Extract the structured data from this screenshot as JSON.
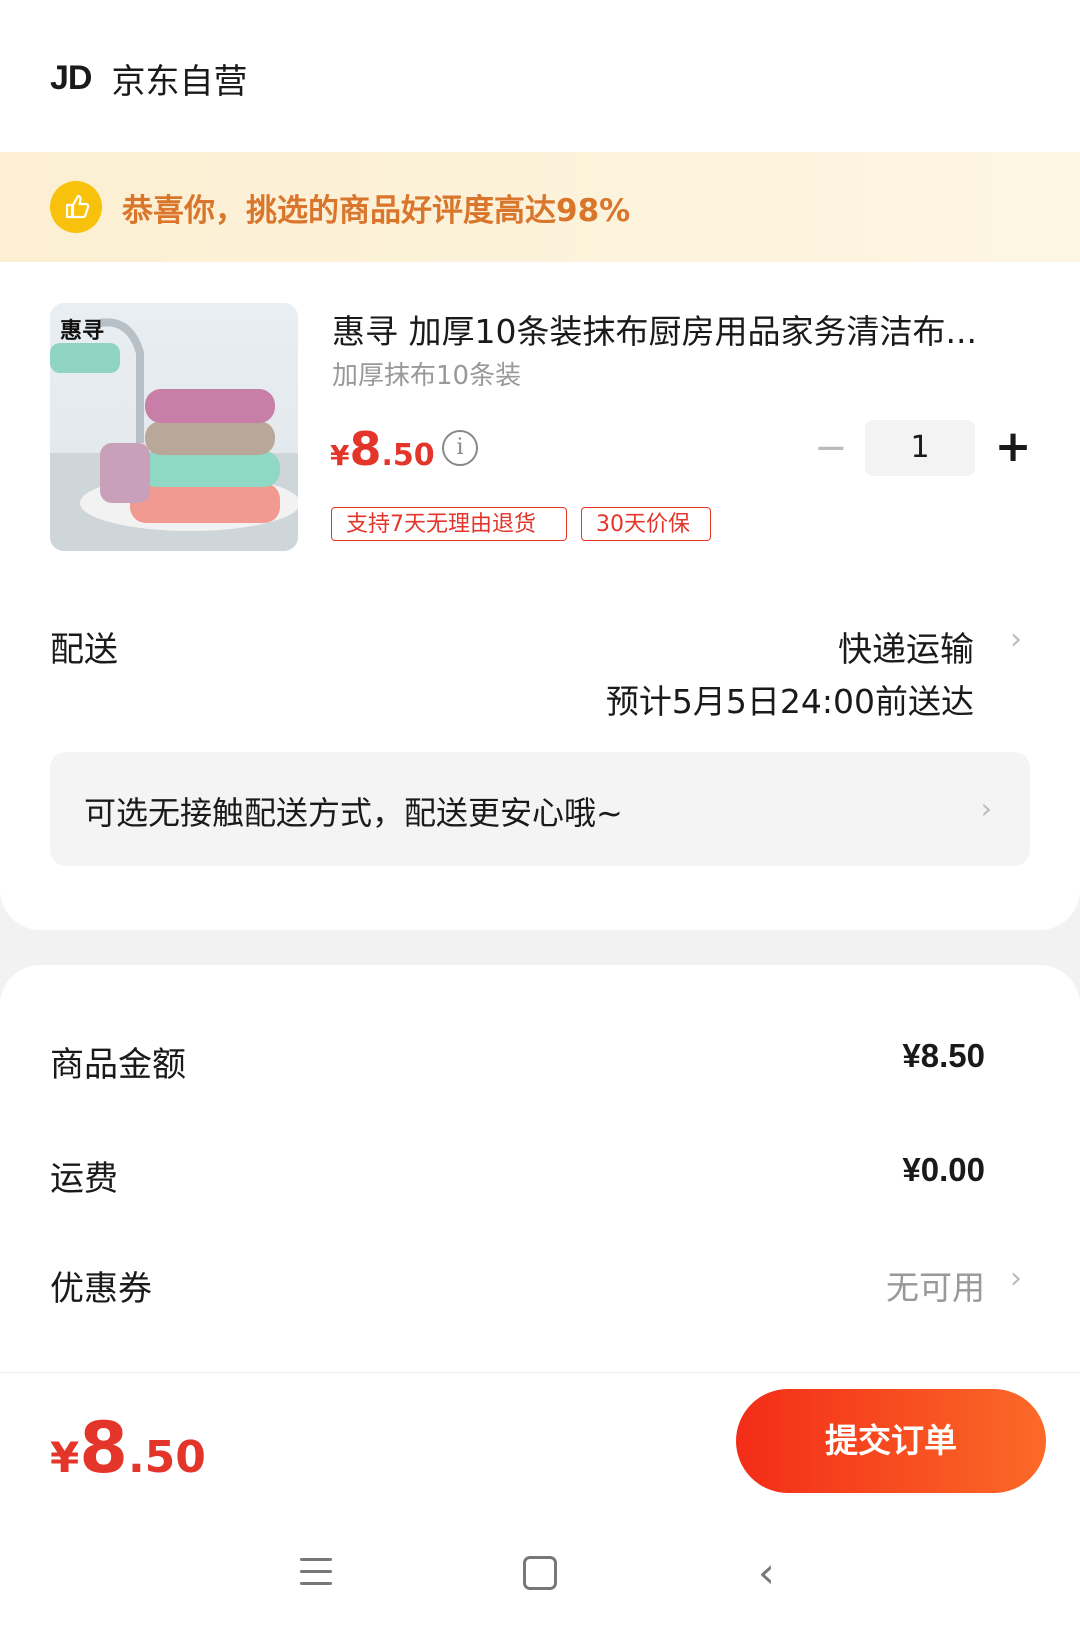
{
  "store": {
    "logo": "JD",
    "name": "京东自营"
  },
  "banner": {
    "text": "恭喜你，挑选的商品好评度高达98%"
  },
  "product": {
    "brand_text": "惠寻",
    "title": "惠寻 加厚10条装抹布厨房用品家务清洁布...",
    "spec": "加厚抹布10条装",
    "price": {
      "currency": "¥",
      "integer": "8",
      "decimal": ".50"
    },
    "info_icon": "i",
    "quantity": "1",
    "minus": "−",
    "plus": "+",
    "tags": [
      "支持7天无理由退货",
      "30天价保"
    ]
  },
  "delivery": {
    "label": "配送",
    "method": "快递运输",
    "eta": "预计5月5日24:00前送达",
    "contactless": "可选无接触配送方式，配送更安心哦~"
  },
  "summary": {
    "goods_label": "商品金额",
    "goods_value": "¥8.50",
    "shipping_label": "运费",
    "shipping_value": "¥0.00",
    "coupon_label": "优惠券",
    "coupon_value": "无可用"
  },
  "footer": {
    "total": {
      "currency": "¥",
      "integer": "8",
      "decimal": ".50"
    },
    "submit_label": "提交订单"
  },
  "colors": {
    "accent": "#e4352b",
    "banner_text": "#d9762b",
    "thumb_icon": "#f8c10c"
  }
}
